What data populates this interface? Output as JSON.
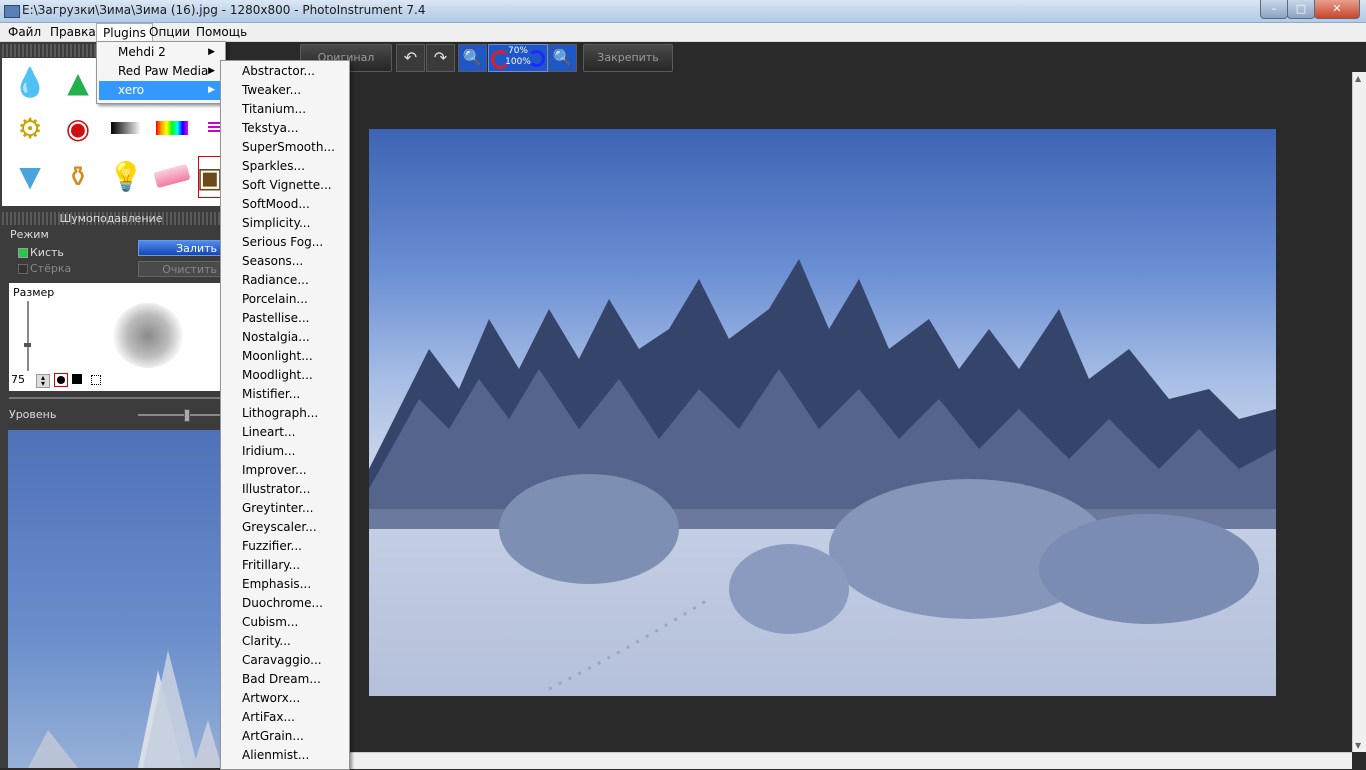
{
  "window": {
    "title": "E:\\Загрузки\\Зима\\Зима (16).jpg - 1280x800 - PhotoInstrument 7.4",
    "controls": {
      "minimize": "–",
      "maximize": "□",
      "close": "✕"
    }
  },
  "menubar": {
    "items": [
      "Файл",
      "Правка",
      "Plugins",
      "Опции",
      "Помощь"
    ],
    "open_item": "Plugins"
  },
  "toolbar": {
    "original_label": "Оригинал",
    "zoom_top": "70%",
    "zoom_bottom": "100%",
    "pin_label": "Закрепить",
    "icons": [
      "undo-icon",
      "redo-icon",
      "zoom-out-icon",
      "zoom-in-icon"
    ]
  },
  "tools_panel": {
    "tools": [
      "drop-icon",
      "cone-icon",
      "clone-stamp-icon",
      "eye-icon",
      "gradient-icon",
      "color-bars-icon",
      "lines-icon",
      "brush-icon",
      "perfume-icon",
      "bulb-icon",
      "eraser-icon",
      "frame-icon"
    ]
  },
  "noise_panel": {
    "title": "Шумоподавление",
    "mode_label": "Режим",
    "brush_label": "Кисть",
    "eraser_label": "Стёрка",
    "fill_button": "Залить",
    "clear_button": "Очистить",
    "size_label": "Размер",
    "size_value": "75",
    "level_label": "Уровень"
  },
  "plugins_menu": {
    "items": [
      {
        "label": "Mehdi 2",
        "has_submenu": true
      },
      {
        "label": "Red Paw Media",
        "has_submenu": true
      },
      {
        "label": "xero",
        "has_submenu": true,
        "selected": true
      }
    ]
  },
  "xero_submenu": {
    "items": [
      "Abstractor...",
      "Tweaker...",
      "Titanium...",
      "Tekstya...",
      "SuperSmooth...",
      "Sparkles...",
      "Soft Vignette...",
      "SoftMood...",
      "Simplicity...",
      "Serious Fog...",
      "Seasons...",
      "Radiance...",
      "Porcelain...",
      "Pastellise...",
      "Nostalgia...",
      "Moonlight...",
      "Moodlight...",
      "Mistifier...",
      "Lithograph...",
      "Lineart...",
      "Iridium...",
      "Improver...",
      "Illustrator...",
      "Greytinter...",
      "Greyscaler...",
      "Fuzzifier...",
      "Fritillary...",
      "Emphasis...",
      "Duochrome...",
      "Cubism...",
      "Clarity...",
      "Caravaggio...",
      "Bad Dream...",
      "Artworx...",
      "ArtiFax...",
      "ArtGrain...",
      "Alienmist..."
    ]
  }
}
